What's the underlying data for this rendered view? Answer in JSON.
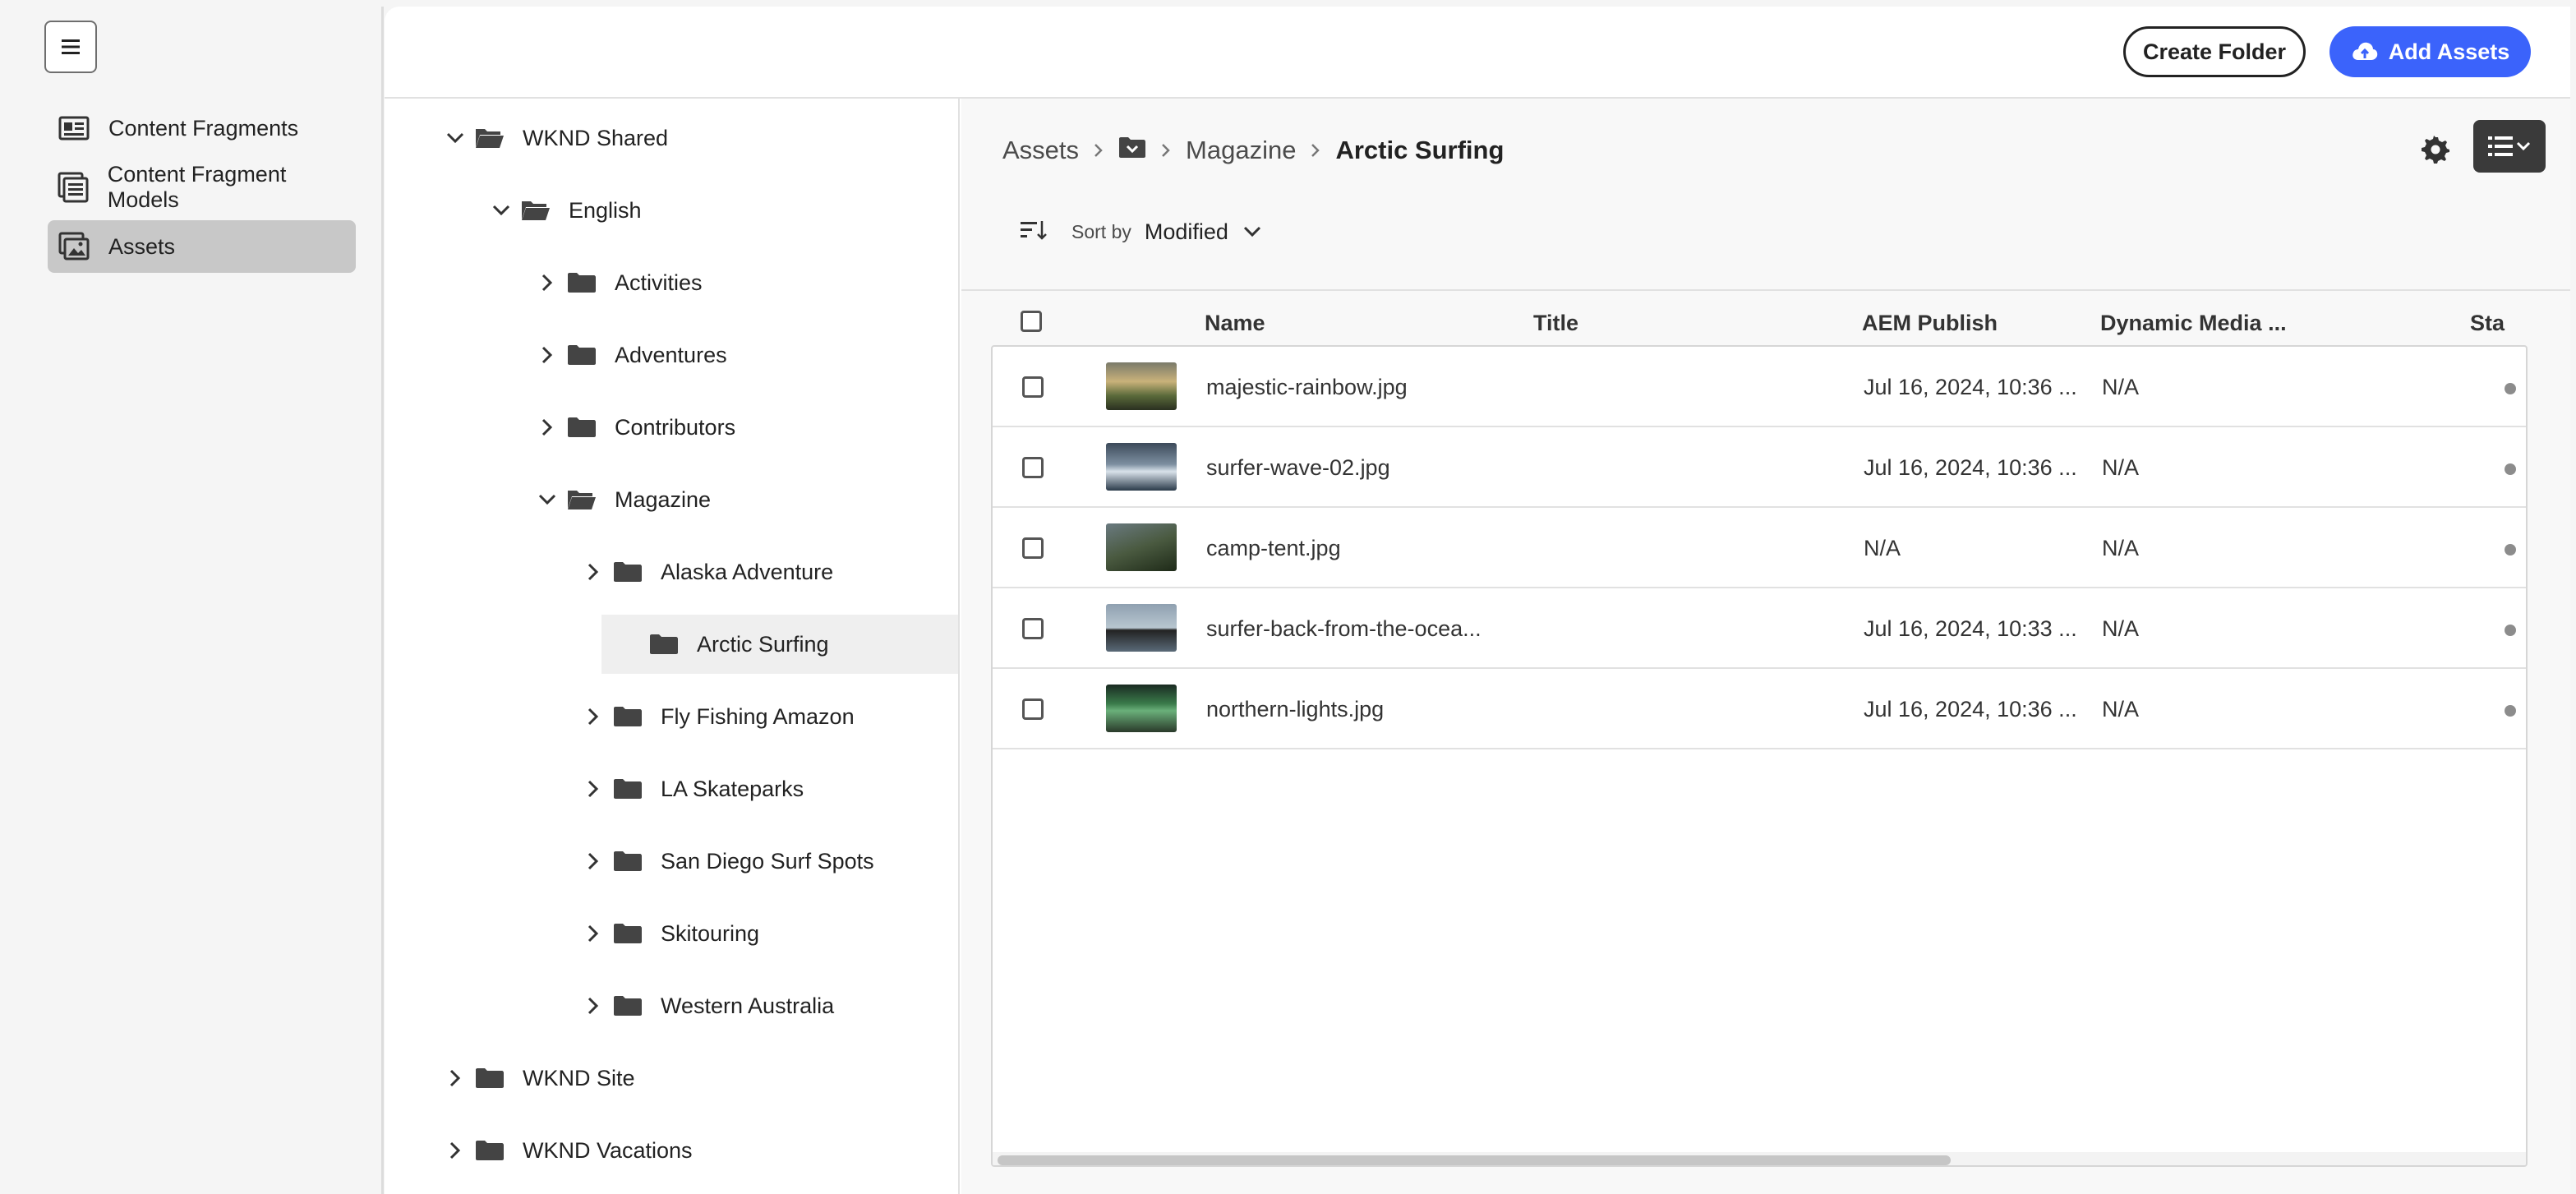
{
  "nav": {
    "items": [
      {
        "label": "Content Fragments",
        "icon": "content-fragments-icon"
      },
      {
        "label": "Content Fragment Models",
        "icon": "content-fragment-models-icon"
      },
      {
        "label": "Assets",
        "icon": "assets-icon",
        "active": true
      }
    ]
  },
  "toolbar": {
    "create_folder": "Create Folder",
    "add_assets": "Add Assets"
  },
  "tree": {
    "items": [
      {
        "label": "WKND Shared",
        "expanded": true
      },
      {
        "label": "English",
        "expanded": true
      },
      {
        "label": "Activities"
      },
      {
        "label": "Adventures"
      },
      {
        "label": "Contributors"
      },
      {
        "label": "Magazine",
        "expanded": true
      },
      {
        "label": "Alaska Adventure"
      },
      {
        "label": "Arctic Surfing",
        "selected": true
      },
      {
        "label": "Fly Fishing Amazon"
      },
      {
        "label": "LA Skateparks"
      },
      {
        "label": "San Diego Surf Spots"
      },
      {
        "label": "Skitouring"
      },
      {
        "label": "Western Australia"
      },
      {
        "label": "WKND Site"
      },
      {
        "label": "WKND Vacations"
      }
    ]
  },
  "breadcrumb": {
    "root": "Assets",
    "middle": "Magazine",
    "current": "Arctic Surfing"
  },
  "sort": {
    "label": "Sort by",
    "value": "Modified"
  },
  "table": {
    "columns": [
      "Name",
      "Title",
      "AEM Publish",
      "Dynamic Media ...",
      "Sta"
    ],
    "rows": [
      {
        "name": "majestic-rainbow.jpg",
        "title": "",
        "aem_publish": "Jul 16, 2024, 10:36 ...",
        "dynamic_media": "N/A"
      },
      {
        "name": "surfer-wave-02.jpg",
        "title": "",
        "aem_publish": "Jul 16, 2024, 10:36 ...",
        "dynamic_media": "N/A"
      },
      {
        "name": "camp-tent.jpg",
        "title": "",
        "aem_publish": "N/A",
        "dynamic_media": "N/A"
      },
      {
        "name": "surfer-back-from-the-ocea...",
        "title": "",
        "aem_publish": "Jul 16, 2024, 10:33 ...",
        "dynamic_media": "N/A"
      },
      {
        "name": "northern-lights.jpg",
        "title": "",
        "aem_publish": "Jul 16, 2024, 10:36 ...",
        "dynamic_media": "N/A"
      }
    ]
  },
  "colors": {
    "accent": "#3b63fb",
    "nav_active": "#c8c8c8",
    "status_dot": "#8c8c8c"
  }
}
